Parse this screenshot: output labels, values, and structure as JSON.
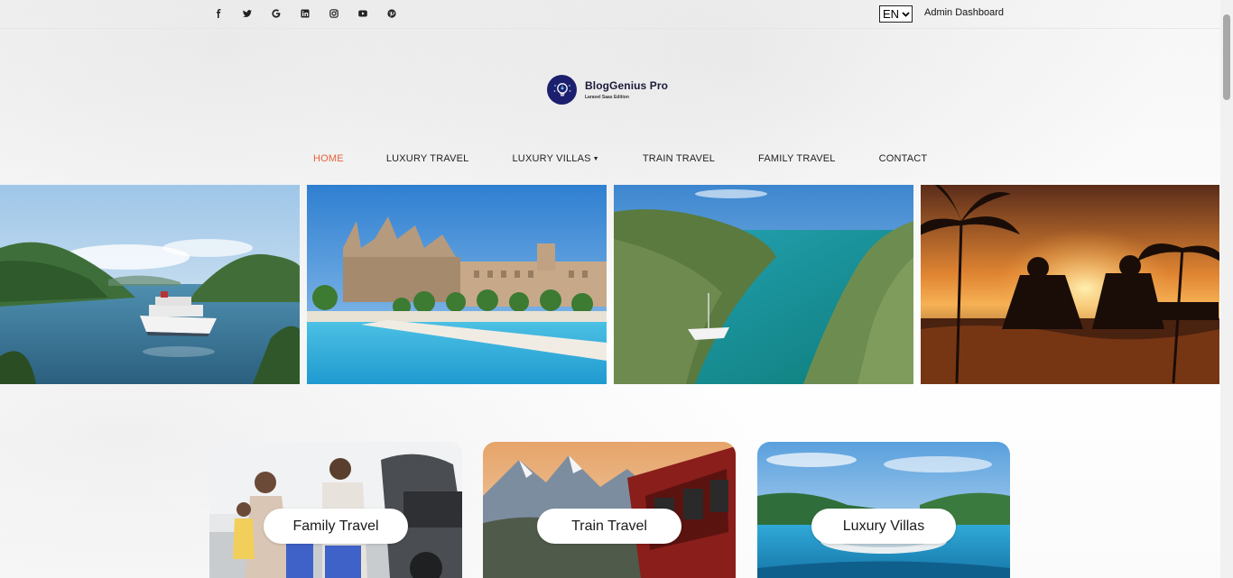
{
  "topbar": {
    "social_icons": [
      "facebook-icon",
      "twitter-icon",
      "google-icon",
      "linkedin-icon",
      "instagram-icon",
      "youtube-icon",
      "pinterest-icon"
    ],
    "social_glyphs": [
      "f",
      "t",
      "G",
      "in",
      "ig",
      "yt",
      "p"
    ],
    "language": "EN",
    "admin_label": "Admin Dashboard"
  },
  "logo": {
    "name": "BlogGenius Pro",
    "tagline": "Laravel Saas Edition"
  },
  "nav": {
    "items": [
      {
        "label": "HOME",
        "active": true
      },
      {
        "label": "LUXURY TRAVEL"
      },
      {
        "label": "LUXURY VILLAS",
        "dropdown": true
      },
      {
        "label": "TRAIN TRAVEL"
      },
      {
        "label": "FAMILY TRAVEL"
      },
      {
        "label": "CONTACT"
      }
    ]
  },
  "hero": {
    "images": [
      "cruise ship in bay",
      "cathedral by waterfront",
      "sailboat in turquoise cove",
      "sunset pool loungers"
    ]
  },
  "categories": [
    {
      "label": "Family Travel"
    },
    {
      "label": "Train Travel"
    },
    {
      "label": "Luxury Villas"
    }
  ],
  "colors": {
    "accent": "#e8613a",
    "logo_bg": "#1c1f6e"
  }
}
